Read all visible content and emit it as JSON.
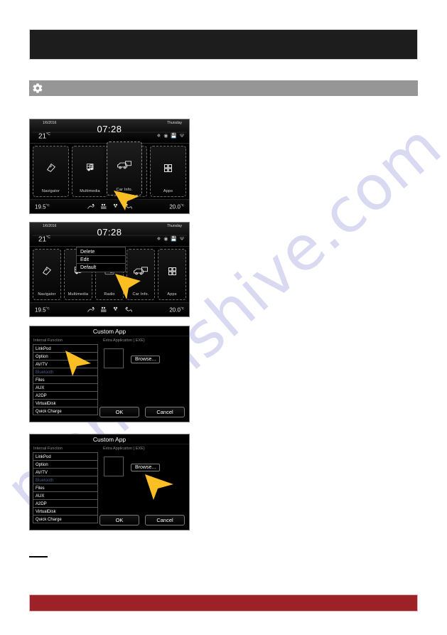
{
  "document": {
    "watermark": "manualshive.com",
    "footer_color": "#9d2227",
    "banner_color": "#1d1d1d",
    "section_bar_color": "#969696"
  },
  "section_bar": {
    "icon": "gear-icon"
  },
  "head_unit": {
    "date": "1/6/2016",
    "day": "Thursday",
    "clock": "07:28",
    "outside_temp": "21",
    "outside_temp_unit": "°C",
    "status_icons": [
      "bluetooth-icon",
      "disc-icon",
      "sd-card-icon",
      "usb-icon"
    ],
    "tiles": [
      {
        "label": "Navigator",
        "icon": "navigator-icon"
      },
      {
        "label": "Multimedia",
        "icon": "multimedia-icon"
      },
      {
        "label": "Radio",
        "icon": "radio-icon"
      },
      {
        "label": "Car Info.",
        "icon": "car-info-icon"
      },
      {
        "label": "Apps",
        "icon": "apps-grid-icon"
      }
    ],
    "climate": {
      "left_temp": "19.5",
      "left_unit": "°C",
      "right_temp": "20.0",
      "right_unit": "°C"
    },
    "context_menu": [
      "Delete",
      "Edit",
      "Default"
    ]
  },
  "custom_app_dialog": {
    "title": "Custom App",
    "internal_function_header": "Internal Function",
    "extra_application_header": "Extra Application ( EXE)",
    "functions": [
      {
        "label": "LinkPod",
        "disabled": false
      },
      {
        "label": "Option",
        "disabled": false
      },
      {
        "label": "AV/TV",
        "disabled": false
      },
      {
        "label": "Bluetooth",
        "disabled": true
      },
      {
        "label": "Files",
        "disabled": false
      },
      {
        "label": "AUX",
        "disabled": false
      },
      {
        "label": "A2DP",
        "disabled": false
      },
      {
        "label": "VirtualDisk",
        "disabled": false
      },
      {
        "label": "Quick Charge",
        "disabled": false
      }
    ],
    "browse_label": "Browse...",
    "ok_label": "OK",
    "cancel_label": "Cancel"
  }
}
